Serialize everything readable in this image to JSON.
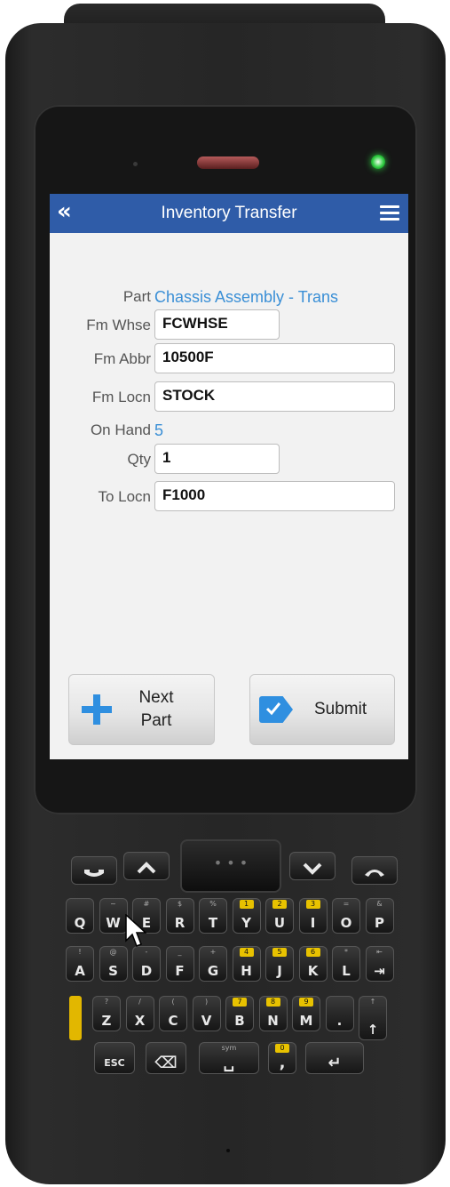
{
  "app": {
    "title": "Inventory Transfer"
  },
  "form": {
    "part": {
      "label": "Part",
      "value": "Chassis Assembly - Trans"
    },
    "fm_whse": {
      "label": "Fm Whse",
      "value": "FCWHSE"
    },
    "fm_abbr": {
      "label": "Fm Abbr",
      "value": "10500F"
    },
    "fm_locn": {
      "label": "Fm Locn",
      "value": "STOCK"
    },
    "on_hand": {
      "label": "On Hand",
      "value": "5"
    },
    "qty": {
      "label": "Qty",
      "value": "1"
    },
    "to_locn": {
      "label": "To Locn",
      "value": "F1000"
    }
  },
  "buttons": {
    "next_part": {
      "line1": "Next",
      "line2": "Part"
    },
    "submit": {
      "label": "Submit"
    }
  },
  "colors": {
    "title_bar": "#2f5ca8",
    "link_text": "#3a8fd6",
    "button_icon": "#2f8fe0"
  },
  "keypad": {
    "nav_center": "• • •",
    "rows": [
      [
        {
          "sub": "",
          "main": "Q"
        },
        {
          "sub": "~",
          "main": "W"
        },
        {
          "sub": "#",
          "main": "E"
        },
        {
          "sub": "$",
          "main": "R"
        },
        {
          "sub": "%",
          "main": "T"
        },
        {
          "sub": "1",
          "main": "Y",
          "yellow": true
        },
        {
          "sub": "2",
          "main": "U",
          "yellow": true
        },
        {
          "sub": "3",
          "main": "I",
          "yellow": true
        },
        {
          "sub": "=",
          "main": "O"
        },
        {
          "sub": "&",
          "main": "P"
        }
      ],
      [
        {
          "sub": "!",
          "main": "A"
        },
        {
          "sub": "@",
          "main": "S"
        },
        {
          "sub": "-",
          "main": "D"
        },
        {
          "sub": "_",
          "main": "F"
        },
        {
          "sub": "+",
          "main": "G"
        },
        {
          "sub": "4",
          "main": "H",
          "yellow": true
        },
        {
          "sub": "5",
          "main": "J",
          "yellow": true
        },
        {
          "sub": "6",
          "main": "K",
          "yellow": true
        },
        {
          "sub": "*",
          "main": "L"
        },
        {
          "sub": "⇤",
          "main": "⇥"
        }
      ],
      [
        {
          "sub": "?",
          "main": "Z"
        },
        {
          "sub": "/",
          "main": "X"
        },
        {
          "sub": "(",
          "main": "C"
        },
        {
          "sub": ")",
          "main": "V"
        },
        {
          "sub": "7",
          "main": "B",
          "yellow": true
        },
        {
          "sub": "8",
          "main": "N",
          "yellow": true
        },
        {
          "sub": "9",
          "main": "M",
          "yellow": true
        },
        {
          "sub": "",
          "main": "."
        },
        {
          "sub": "↑",
          "main": "↑"
        }
      ]
    ],
    "bottom": [
      {
        "main": "ESC"
      },
      {
        "main": "⌫"
      },
      {
        "sub": "sym",
        "main": "␣"
      },
      {
        "sub": "0",
        "main": ",",
        "yellow": true
      },
      {
        "main": "↵"
      }
    ]
  }
}
